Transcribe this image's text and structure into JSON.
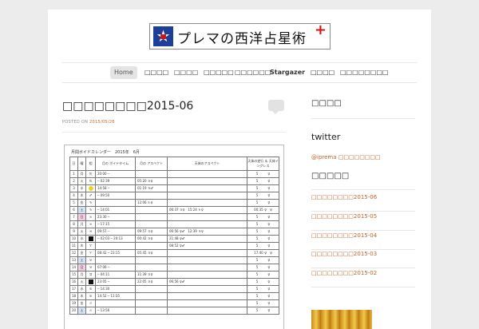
{
  "site": {
    "logo_text": "プレマの西洋占星術",
    "logo_plus": "+",
    "icon": "star-logo-icon"
  },
  "nav": {
    "items": [
      {
        "label": "Home"
      },
      {
        "label": "□□□□"
      },
      {
        "label": "□□□□"
      },
      {
        "label": "□□□□□"
      },
      {
        "label": "□□□□□□"
      },
      {
        "label": "Stargazer"
      },
      {
        "label": "□□□□"
      },
      {
        "label": "□□□□□□□□"
      }
    ]
  },
  "post": {
    "title": "□□□□□□□□2015-06",
    "posted_on": "POSTED ON",
    "date": "2015/05/26",
    "comment_icon": "comment-bubble-icon"
  },
  "calendar": {
    "title": "月間ボイドカレンダー　2015年　6月",
    "headers": [
      "日",
      "曜",
      "相",
      "月の\nボイドタイム",
      "月の\nアスペクト",
      "天体のアスペクト",
      "天体の逆行 ＆\n天体イングレス"
    ],
    "rows": [
      {
        "d": "1",
        "w": "月",
        "s": "♏",
        "void": "20:00 ─",
        "asp": "",
        "planets": "",
        "retro": "5　　　♀"
      },
      {
        "d": "2",
        "w": "火",
        "s": "♏",
        "void": "─ 02:39",
        "asp": "05:20 ♃♀",
        "planets": "",
        "retro": "5　　　♀"
      },
      {
        "d": "3",
        "w": "水",
        "s": "♐",
        "void": "14:58 ─",
        "asp": "01:19 ♃♂",
        "planets": "",
        "retro": "5　　　♀"
      },
      {
        "d": "4",
        "w": "木",
        "s": "♐",
        "void": "─ 09:50",
        "asp": "",
        "planets": "",
        "retro": "5　　　♀"
      },
      {
        "d": "5",
        "w": "金",
        "s": "♑",
        "void": "",
        "asp": "12:06 ♄♀",
        "planets": "",
        "retro": "5　　　♀"
      },
      {
        "d": "6",
        "w": "土",
        "s": "♑",
        "void": "─ 14:01",
        "asp": "",
        "planets": "06:37 ♃♀　15:24 ♄♀",
        "retro": "00:35 ♀　♀"
      },
      {
        "d": "7",
        "w": "日",
        "s": "♒",
        "void": "23:30 ─",
        "asp": "",
        "planets": "",
        "retro": "5　　　♀"
      },
      {
        "d": "8",
        "w": "月",
        "s": "♒",
        "void": "─ 17:15",
        "asp": "",
        "planets": "",
        "retro": "5　　　♀"
      },
      {
        "d": "9",
        "w": "火",
        "s": "♓",
        "void": "09:57 ─",
        "asp": "09:57 ♃♀",
        "planets": "06:56 ♀♂　12:39 ♃♀",
        "retro": "5　　　♀"
      },
      {
        "d": "10",
        "w": "水",
        "s": "♓",
        "void": "─ 02:03 ─ 20:13",
        "asp": "00:42 ♃♀",
        "planets": "21:48 ♀♂",
        "retro": "5　　　♀"
      },
      {
        "d": "11",
        "w": "木",
        "s": "♈",
        "void": "",
        "asp": "",
        "planets": "08:52 ♀♂",
        "retro": "5　　　♀"
      },
      {
        "d": "12",
        "w": "金",
        "s": "♈",
        "void": "08:42 ─ 23:15",
        "asp": "05:45 ♃♀",
        "planets": "",
        "retro": "17:40 ♀　♀"
      },
      {
        "d": "13",
        "w": "土",
        "s": "♉",
        "void": "",
        "asp": "",
        "planets": "",
        "retro": "5　　　♀"
      },
      {
        "d": "14",
        "w": "日",
        "s": "♉",
        "void": "07:06 ─",
        "asp": "",
        "planets": "",
        "retro": "5　　　♀"
      },
      {
        "d": "15",
        "w": "月",
        "s": "♊",
        "void": "─ 04:11",
        "asp": "11:39 ♃♀",
        "planets": "",
        "retro": "5　　　♀"
      },
      {
        "d": "16",
        "w": "火",
        "s": "♊",
        "void": "23:05 ─",
        "asp": "22:05 ♃♀",
        "planets": "06:56 ♀♂",
        "retro": "5　　　♀"
      },
      {
        "d": "17",
        "w": "水",
        "s": "♋",
        "void": "─ 14:30",
        "asp": "",
        "planets": "",
        "retro": "5　　　♀"
      },
      {
        "d": "18",
        "w": "木",
        "s": "♋",
        "void": "14:52 ─ 11:35",
        "asp": "",
        "planets": "",
        "retro": "5　　　♀"
      },
      {
        "d": "19",
        "w": "金",
        "s": "♌",
        "void": "",
        "asp": "",
        "planets": "",
        "retro": "5　　　♀"
      },
      {
        "d": "20",
        "w": "土",
        "s": "♌",
        "void": "─ 13:56",
        "asp": "",
        "planets": "",
        "retro": "5　　　♀"
      }
    ]
  },
  "sidebar": {
    "heading1": "□□□□",
    "twitter": "twitter",
    "twitter_link": "@iprema □□□□□□□□",
    "heading2": "□□□□□",
    "recent_posts": [
      "□□□□□□□□2015-06",
      "□□□□□□□□2015-05",
      "□□□□□□□□2015-04",
      "□□□□□□□□2015-03",
      "□□□□□□□□2015-02"
    ]
  }
}
